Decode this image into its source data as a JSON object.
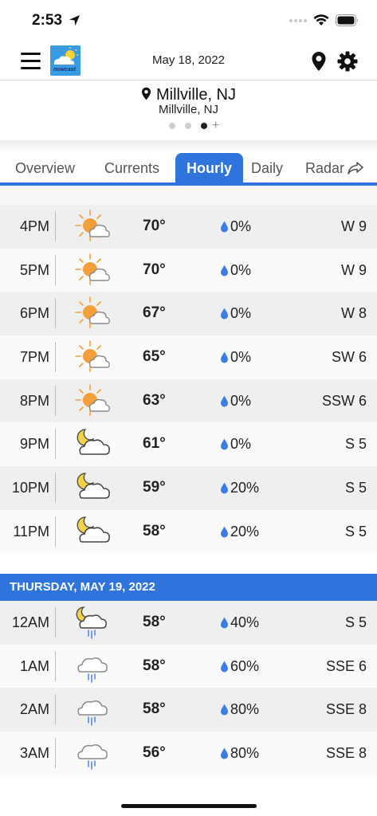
{
  "status_bar": {
    "time": "2:53"
  },
  "header": {
    "date": "May 18, 2022",
    "logo_text": "nowcast"
  },
  "location": {
    "title": "Millville, NJ",
    "subtitle": "Millville, NJ"
  },
  "tabs": [
    {
      "label": "Overview",
      "active": false
    },
    {
      "label": "Currents",
      "active": false
    },
    {
      "label": "Hourly",
      "active": true
    },
    {
      "label": "Daily",
      "active": false
    },
    {
      "label": "Radar",
      "active": false
    }
  ],
  "today_hours": [
    {
      "time": "4PM",
      "icon": "sun-cloud-icon",
      "temp": "70°",
      "precip": "0%",
      "wind": "W 9"
    },
    {
      "time": "5PM",
      "icon": "sun-cloud-icon",
      "temp": "70°",
      "precip": "0%",
      "wind": "W 9"
    },
    {
      "time": "6PM",
      "icon": "sun-cloud-icon",
      "temp": "67°",
      "precip": "0%",
      "wind": "W 8"
    },
    {
      "time": "7PM",
      "icon": "sun-cloud-icon",
      "temp": "65°",
      "precip": "0%",
      "wind": "SW 6"
    },
    {
      "time": "8PM",
      "icon": "sun-cloud-icon",
      "temp": "63°",
      "precip": "0%",
      "wind": "SSW 6"
    },
    {
      "time": "9PM",
      "icon": "moon-cloud-icon",
      "temp": "61°",
      "precip": "0%",
      "wind": "S 5"
    },
    {
      "time": "10PM",
      "icon": "moon-cloud-icon",
      "temp": "59°",
      "precip": "20%",
      "wind": "S 5"
    },
    {
      "time": "11PM",
      "icon": "moon-cloud-icon",
      "temp": "58°",
      "precip": "20%",
      "wind": "S 5"
    }
  ],
  "next_day": {
    "label": "THURSDAY, MAY 19, 2022",
    "hours": [
      {
        "time": "12AM",
        "icon": "moon-cloud-rain-icon",
        "temp": "58°",
        "precip": "40%",
        "wind": "S 5"
      },
      {
        "time": "1AM",
        "icon": "cloud-rain-icon",
        "temp": "58°",
        "precip": "60%",
        "wind": "SSE 6"
      },
      {
        "time": "2AM",
        "icon": "cloud-rain-icon",
        "temp": "58°",
        "precip": "80%",
        "wind": "SSE 8"
      },
      {
        "time": "3AM",
        "icon": "cloud-rain-icon",
        "temp": "56°",
        "precip": "80%",
        "wind": "SSE 8"
      }
    ]
  },
  "colors": {
    "accent": "#2f74dc",
    "sun": "#f4a03a",
    "rain": "#3b7de3"
  }
}
